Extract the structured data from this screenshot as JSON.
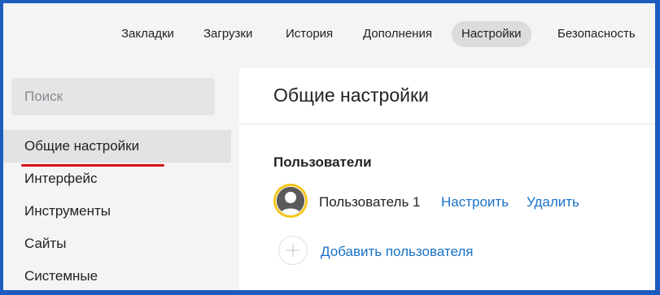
{
  "topbar": {
    "tabs": [
      {
        "label": "Закладки"
      },
      {
        "label": "Загрузки"
      },
      {
        "label": "История"
      },
      {
        "label": "Дополнения"
      },
      {
        "label": "Настройки",
        "active": true
      },
      {
        "label": "Безопасность"
      }
    ]
  },
  "sidebar": {
    "search_placeholder": "Поиск",
    "items": [
      {
        "label": "Общие настройки",
        "active": true
      },
      {
        "label": "Интерфейс"
      },
      {
        "label": "Инструменты"
      },
      {
        "label": "Сайты"
      },
      {
        "label": "Системные"
      }
    ]
  },
  "main": {
    "title": "Общие настройки",
    "users_section": {
      "title": "Пользователи",
      "user_name": "Пользователь 1",
      "configure_label": "Настроить",
      "delete_label": "Удалить",
      "add_user_label": "Добавить пользователя"
    }
  },
  "colors": {
    "frame": "#1e5bbf",
    "link": "#1a73c8",
    "active_underline": "#d8101a",
    "avatar_ring": "#f5c518"
  }
}
